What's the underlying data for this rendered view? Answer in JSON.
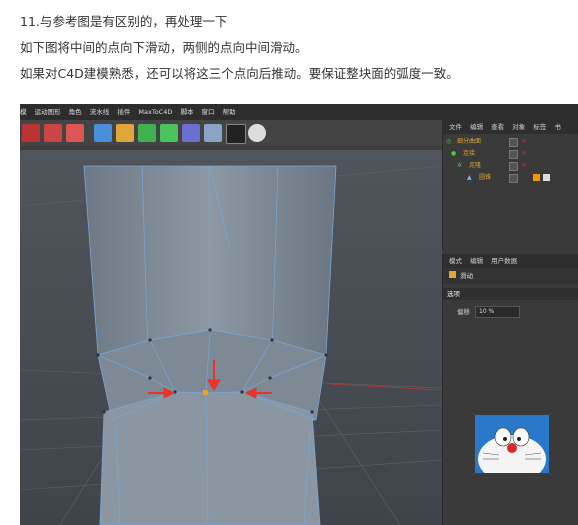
{
  "article": {
    "line1_num": "11.",
    "line1": "与参考图是有区别的，再处理一下",
    "line2": "如下图将中间的点向下滑动，两侧的点向中间滑动。",
    "line3": "如果对C4D建模熟悉，还可以将这三个点向后推动。要保证整块面的弧度一致。"
  },
  "menubar": {
    "items": [
      "模",
      "运动图形",
      "角色",
      "流水线",
      "插件",
      "MaxToC4D",
      "脚本",
      "窗口",
      "帮助"
    ]
  },
  "viewport": {
    "nav_label": "✥⇣⟲⊡"
  },
  "object_manager": {
    "tabs": [
      "文件",
      "编辑",
      "查看",
      "对象",
      "标签",
      "书"
    ],
    "objects": [
      {
        "name": "细分曲面"
      },
      {
        "name": "连接"
      },
      {
        "name": "克隆"
      },
      {
        "name": "圆锥"
      }
    ]
  },
  "attribute_manager": {
    "tabs": [
      "模式",
      "编辑",
      "用户数据"
    ],
    "tool_name": "滑动",
    "group": "选项",
    "field_label": "偏移",
    "field_value": "10 %"
  },
  "colors": {
    "arrow": "#e8342b",
    "selected_point": "#f0a020",
    "wire": "#7aa7d8"
  }
}
